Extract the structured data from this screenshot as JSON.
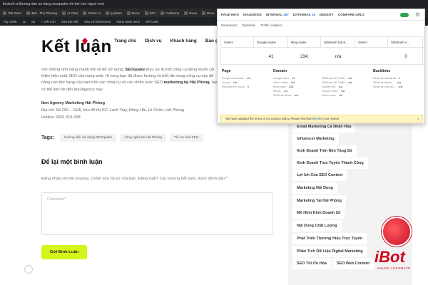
{
  "browser": {
    "url": "ibotsoft.vn/huong-dan-su-dung-seoquake-chi-tiet-cho-nguoi-moi/",
    "bookmarks": [
      "Tab Docs",
      "iBot - Thu Phuong",
      "AI Chat",
      "Check AI",
      "ly pham",
      "Ruou",
      "SPA",
      "Funhome",
      "Ruou",
      "Ruou",
      "Kit V"
    ]
  },
  "wp_admin_bar": {
    "items": [
      "Tùy chỉnh",
      "11",
      "62",
      "+ Viết mới",
      "Sửa bài viết",
      "Sửa với Elementor",
      "Rank Math SEO",
      "WPCode"
    ]
  },
  "site_nav": {
    "links": [
      "Trang chủ",
      "Dịch vụ",
      "Khách hàng",
      "Bảo giá"
    ]
  },
  "article": {
    "heading": "Kết luận",
    "para_1": "Với những tính năng mạnh mẽ về dữ sử dụng, ",
    "para_bold": "SEOquake",
    "para_2": " thực sự là một công cụ đang muốn cải thiện hiệu suất SEO của trang web. Hi vọng bạn đã được hướng và biết tận dụng công cụ này để nâng cao thứ hạng của bạn trên các công cụ về các chiến lược SEO ",
    "para_bold_2": "marketing tại Hải Phòng",
    "para_3": ", bạn có thể liên hệ đến Ibot Agency nay:",
    "company": "Ibot Agency Marketing Hải Phòng",
    "address": "Địa chỉ: Số 299 – GH5, khu đô thị ICC Lạch Tray, Đông Hải, Lê Chân, Hải Phòng",
    "hotline": "Hotline: 0901 501 008"
  },
  "tags": {
    "label": "Tags:",
    "items": [
      "hướng dẫn sử dụng SEOquake",
      "công nghệ tại Hải Phòng",
      "Tối ưu hóa SEO"
    ]
  },
  "comments": {
    "title": "Để lại một bình luận",
    "note": "Đăng nhập với tên phuong. Chỉnh sửa hồ sơ của bạn. Đăng xuất? Các trường bắt buộc được đánh dấu",
    "req": "*",
    "placeholder": "Comment*",
    "submit": "Gửi Bình Luận"
  },
  "sidebar_tags": [
    "Email Marketing Cá Nhân Hóa",
    "Influencer Marketing",
    "Kinh Doanh Trên Nền Tảng Số",
    "Kinh Doanh Trực Tuyến Thành Công",
    "Lợi Ích Của SEO Content",
    "Marketing Nội Dung",
    "Marketing Tại Hải Phòng",
    "Mô Hình Kinh Doanh Số",
    "Nội Dung Chất Lượng",
    "Phát Triển Thương Hiệu Trực Tuyến",
    "Phân Tích Dữ Liệu Digital Marketing",
    "SEO Tối Ưu Hóa",
    "SEO Web Content"
  ],
  "brand": {
    "word": "iBot",
    "tagline": "SALES AUTOMATE",
    "red": "#d0021b"
  },
  "seoquake": {
    "tabs": [
      "PAGE INFO",
      "DIAGNOSIS",
      "INTERNAL",
      "EXTERNAL",
      "DENSITY",
      "COMPARE URLS"
    ],
    "internal_count": "167",
    "external_count": "16",
    "subtabs": [
      "Parameters",
      "Backlinks",
      "Traffic Analytics"
    ],
    "columns": [
      "Select",
      "Google index",
      "Bing index",
      "SEMrush back...",
      "Select",
      "SEMrush s..."
    ],
    "values": [
      "",
      "41",
      "234;",
      "n/a",
      "",
      "0"
    ],
    "sections": [
      "Page",
      "Domain",
      "Backlinks"
    ],
    "page_rows": [
      "Google cachedate",
      "Source",
      "Pinterest Pin count"
    ],
    "page_vals": [
      "n/a",
      "n/a",
      "0"
    ],
    "domain_rows_a": [
      "Google index",
      "Yahoo index",
      "Bing index",
      "Whois",
      "SEMrush Rank"
    ],
    "domain_vals_a": [
      "41",
      "n/a",
      "234;",
      "n/a",
      "n/a"
    ],
    "domain_rows_b": [
      "SEMrush SE Traffic",
      "SEMrush SE Traffic",
      "Yandex IKS",
      "Yandex index",
      "Baidu index"
    ],
    "domain_vals_b": [
      "n/a",
      "n/a",
      "n/a",
      "n/a",
      "n/a"
    ],
    "backlink_rows": [
      "SEMrush backlinks",
      "SEMrush linkdo...",
      "SEMrush root do..."
    ],
    "backlink_vals": [
      "0",
      "n/a",
      "n/a"
    ],
    "banner_1": "We have updated the terms of our privacy policy. Please find them ",
    "banner_link": "here",
    "banner_2": " for your review."
  }
}
